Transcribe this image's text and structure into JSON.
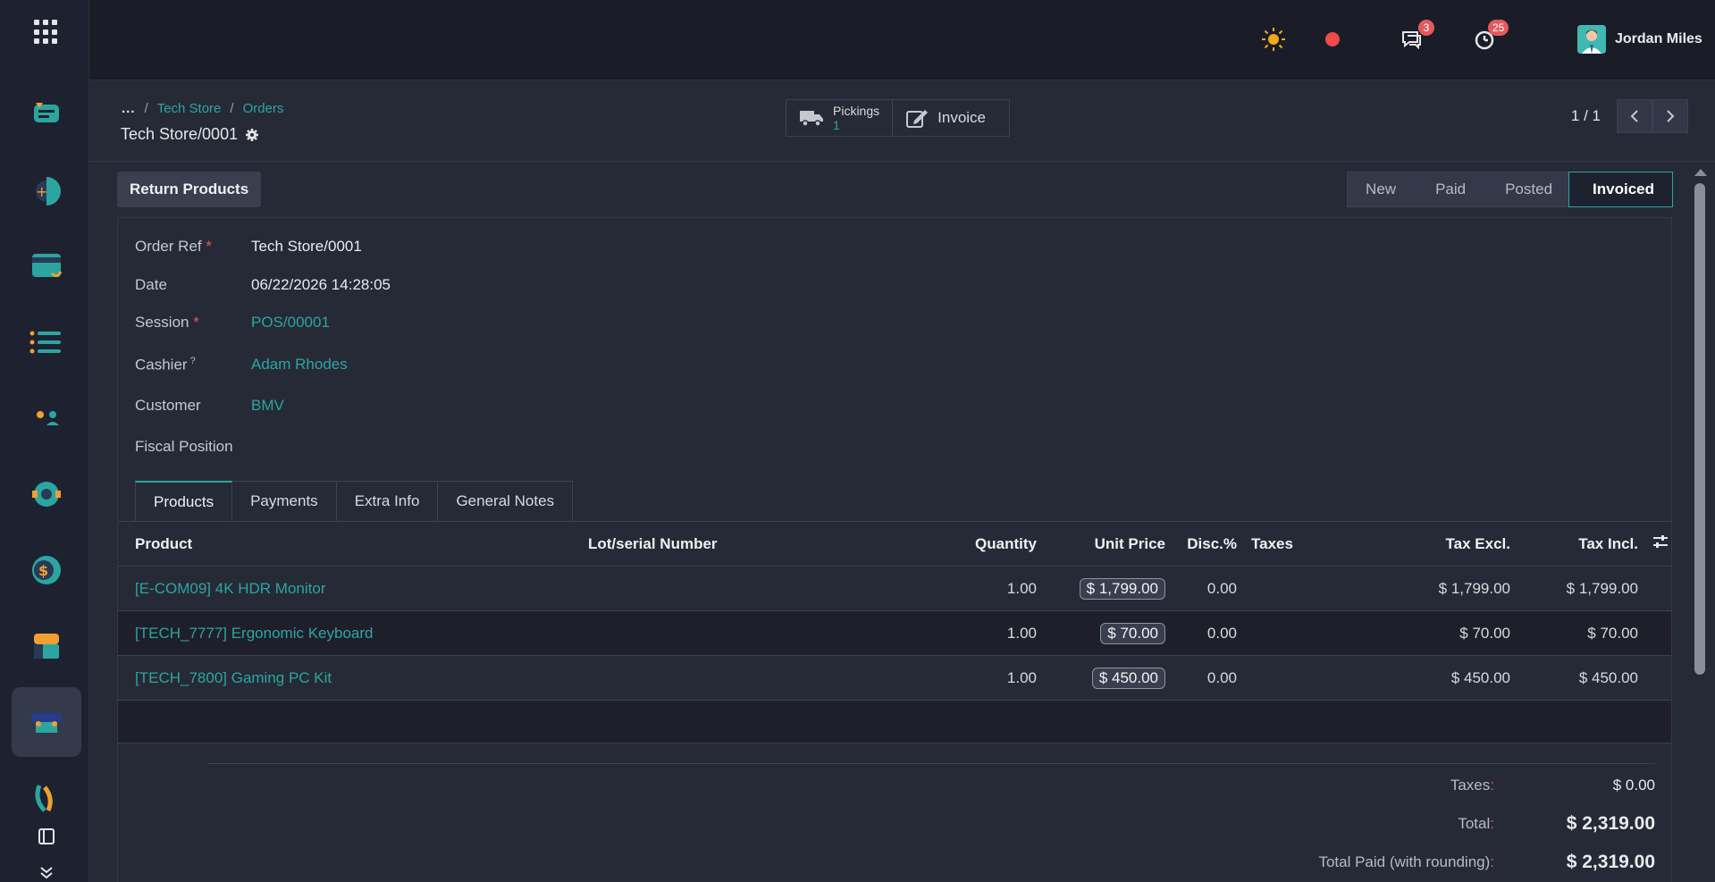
{
  "sidebar": {
    "apps": [
      {
        "name": "discuss",
        "color": "#2CA5A0",
        "accent": "#F0A030"
      },
      {
        "name": "crm",
        "color": "#2CA5A0",
        "accent": "#F0A030"
      },
      {
        "name": "sales",
        "color": "#2CA5A0",
        "accent": "#F0A030"
      },
      {
        "name": "project",
        "color": "#2CA5A0",
        "accent": "#F0A030"
      },
      {
        "name": "employees",
        "color": "#2CA5A0",
        "accent": "#F0A030"
      },
      {
        "name": "settings",
        "color": "#2CA5A0",
        "accent": "#F0A030"
      },
      {
        "name": "accounting",
        "color": "#2CA5A0",
        "accent": "#F0A030"
      },
      {
        "name": "inventory",
        "color": "#2CA5A0",
        "accent": "#F0A030"
      },
      {
        "name": "point-of-sale",
        "color": "#2CA5A0",
        "accent": "#F0A030"
      },
      {
        "name": "studio",
        "color": "#2CA5A0",
        "accent": "#F0A030"
      }
    ]
  },
  "navbar": {
    "messages_count": "3",
    "activities_count": "25",
    "user_name": "Jordan Miles"
  },
  "control": {
    "breadcrumb": {
      "dots": "...",
      "items": [
        "Tech Store",
        "Orders"
      ]
    },
    "record_title": "Tech Store/0001",
    "smart_buttons": {
      "pickings_label": "Pickings",
      "pickings_value": "1",
      "invoice_label": "Invoice"
    },
    "pager": "1 / 1"
  },
  "actions": {
    "return_products": "Return Products"
  },
  "statusbar": {
    "stages": [
      "New",
      "Paid",
      "Posted",
      "Invoiced"
    ],
    "active": "Invoiced"
  },
  "form": {
    "order_ref": {
      "label": "Order Ref",
      "value": "Tech Store/0001"
    },
    "date": {
      "label": "Date",
      "value": "06/22/2026 14:28:05"
    },
    "session": {
      "label": "Session",
      "value": "POS/00001"
    },
    "cashier": {
      "label": "Cashier",
      "value": "Adam Rhodes"
    },
    "customer": {
      "label": "Customer",
      "value": "BMV"
    },
    "fiscal_position": {
      "label": "Fiscal Position",
      "value": ""
    }
  },
  "tabs": [
    "Products",
    "Payments",
    "Extra Info",
    "General Notes"
  ],
  "table": {
    "headers": {
      "product": "Product",
      "lot": "Lot/serial Number",
      "quantity": "Quantity",
      "unit_price": "Unit Price",
      "disc": "Disc.%",
      "taxes": "Taxes",
      "tax_excl": "Tax Excl.",
      "tax_incl": "Tax Incl."
    },
    "rows": [
      {
        "product": "[E-COM09] 4K HDR Monitor",
        "lot": "",
        "quantity": "1.00",
        "unit_price": "$ 1,799.00",
        "disc": "0.00",
        "taxes": "",
        "tax_excl": "$ 1,799.00",
        "tax_incl": "$ 1,799.00"
      },
      {
        "product": "[TECH_7777] Ergonomic Keyboard",
        "lot": "",
        "quantity": "1.00",
        "unit_price": "$ 70.00",
        "disc": "0.00",
        "taxes": "",
        "tax_excl": "$ 70.00",
        "tax_incl": "$ 70.00"
      },
      {
        "product": "[TECH_7800] Gaming PC Kit",
        "lot": "",
        "quantity": "1.00",
        "unit_price": "$ 450.00",
        "disc": "0.00",
        "taxes": "",
        "tax_excl": "$ 450.00",
        "tax_incl": "$ 450.00"
      }
    ]
  },
  "totals": {
    "taxes_label": "Taxes",
    "taxes_value": "$ 0.00",
    "total_label": "Total",
    "total_value": "$ 2,319.00",
    "paid_label": "Total Paid (with rounding)",
    "paid_value": "$ 2,319.00"
  },
  "colors": {
    "accent": "#2CA5A0",
    "danger": "#E45A5A",
    "background": "#262A36",
    "navbar": "#1A1D27"
  }
}
